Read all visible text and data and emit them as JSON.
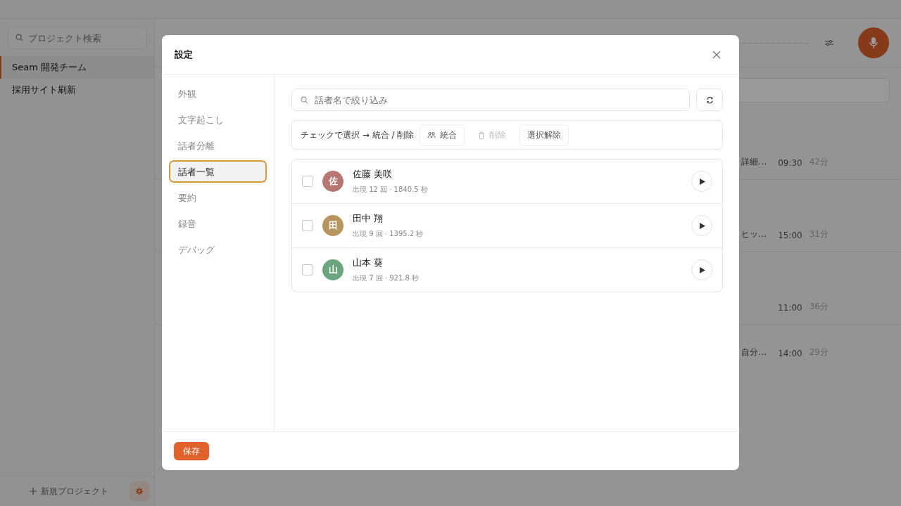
{
  "app": {
    "sidebar": {
      "search": {
        "placeholder": "プロジェクト検索"
      },
      "projects": [
        {
          "name": "Seam 開発チーム",
          "selected": true
        },
        {
          "name": "採用サイト刷新",
          "selected": false
        }
      ],
      "new_project": "新規プロジェクト"
    },
    "meetings": [
      {
        "snippet": "詳細…",
        "time": "09:30",
        "duration": "42分"
      },
      {
        "snippet": "ヒッ…",
        "time": "15:00",
        "duration": "31分"
      },
      {
        "time": "11:00",
        "duration": "36分"
      },
      {
        "snippet": "自分…",
        "time": "14:00",
        "duration": "29分"
      }
    ]
  },
  "modal": {
    "title": "設定",
    "nav": [
      {
        "label": "外観",
        "selected": false
      },
      {
        "label": "文字起こし",
        "selected": false
      },
      {
        "label": "話者分離",
        "selected": false
      },
      {
        "label": "話者一覧",
        "selected": true
      },
      {
        "label": "要約",
        "selected": false
      },
      {
        "label": "録音",
        "selected": false
      },
      {
        "label": "デバッグ",
        "selected": false
      }
    ],
    "filter": {
      "placeholder": "話者名で絞り込み"
    },
    "toolbar": {
      "hint": "チェックで選択 → 統合 / 削除",
      "actions": [
        {
          "kind": "merge",
          "label": "統合",
          "disabled": false
        },
        {
          "kind": "delete",
          "label": "削除",
          "disabled": true
        },
        {
          "kind": "clear",
          "label": "選択解除",
          "disabled": false
        }
      ]
    },
    "speakers": [
      {
        "initial": "佐",
        "name": "佐藤 美咲",
        "stats": "出現 12 回 · 1840.5 秒",
        "color": "#b87672",
        "checked": false
      },
      {
        "initial": "田",
        "name": "田中 翔",
        "stats": "出現 9 回 · 1395.2 秒",
        "color": "#b8955e",
        "checked": false
      },
      {
        "initial": "山",
        "name": "山本 葵",
        "stats": "出現 7 回 · 921.8 秒",
        "color": "#6aa57e",
        "checked": false
      }
    ],
    "save": "保存"
  }
}
